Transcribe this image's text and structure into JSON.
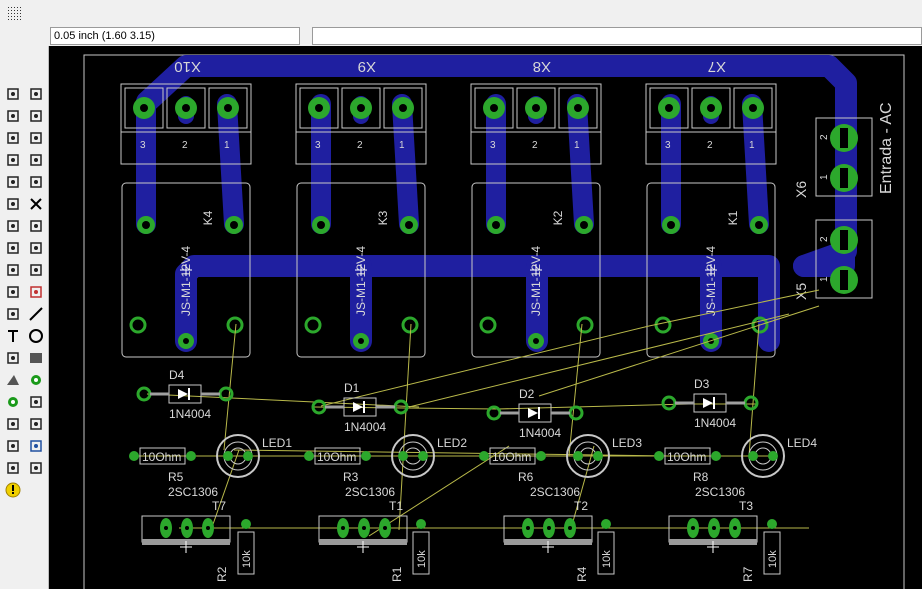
{
  "coord_readout": "0.05 inch (1.60 3.15)",
  "command_value": "",
  "toolbar": {
    "tools": [
      "info",
      "show",
      "display-layers",
      "mark",
      "move",
      "copy",
      "mirror",
      "rotate",
      "group",
      "change",
      "paste",
      "delete",
      "add",
      "name",
      "value",
      "smash",
      "split",
      "miter",
      "optimize",
      "route",
      "ripup",
      "wire",
      "text",
      "circle",
      "arc",
      "rect",
      "polygon",
      "via",
      "signal",
      "hole",
      "attribute",
      "dimension",
      "ratsnest",
      "drc",
      "auto-route",
      "errc",
      "errors"
    ]
  },
  "board": {
    "edge_color": "#c8c8c8",
    "bottom_copper_color": "#1f1fa0",
    "pad_color": "#2ca82c",
    "airwire_color": "#b9b94a",
    "label_color": "#d8d8d8",
    "connectors_top": [
      {
        "name": "X10",
        "pins": [
          "3",
          "2",
          "1"
        ]
      },
      {
        "name": "X9",
        "pins": [
          "3",
          "2",
          "1"
        ]
      },
      {
        "name": "X8",
        "pins": [
          "3",
          "2",
          "1"
        ]
      },
      {
        "name": "X7",
        "pins": [
          "3",
          "2",
          "1"
        ]
      }
    ],
    "relays": [
      {
        "name": "K4",
        "value": "JS-M1-12V-4"
      },
      {
        "name": "K3",
        "value": "JS-M1-12V-4"
      },
      {
        "name": "K2",
        "value": "JS-M1-12V-4"
      },
      {
        "name": "K1",
        "value": "JS-M1-12V-4"
      }
    ],
    "diodes": [
      {
        "name": "D4",
        "value": "1N4004"
      },
      {
        "name": "D1",
        "value": "1N4004"
      },
      {
        "name": "D2",
        "value": "1N4004"
      },
      {
        "name": "D3",
        "value": "1N4004"
      }
    ],
    "resistors_row": [
      {
        "name": "R5",
        "value": "10Ohm"
      },
      {
        "name": "R3",
        "value": "10Ohm"
      },
      {
        "name": "R6",
        "value": "10Ohm"
      },
      {
        "name": "R8",
        "value": "10Ohm"
      }
    ],
    "leds": [
      "LED1",
      "LED2",
      "LED3",
      "LED4"
    ],
    "transistors": [
      {
        "name": "T7",
        "value": "2SC1306"
      },
      {
        "name": "T1",
        "value": "2SC1306"
      },
      {
        "name": "T2",
        "value": "2SC1306"
      },
      {
        "name": "T3",
        "value": "2SC1306"
      }
    ],
    "resistors_vertical": [
      {
        "name": "R2",
        "value": "10k"
      },
      {
        "name": "R1",
        "value": "10k"
      },
      {
        "name": "R4",
        "value": "10k"
      },
      {
        "name": "R7",
        "value": "10k"
      }
    ],
    "power_connectors": [
      {
        "name": "X6",
        "pins": [
          "2",
          "1"
        ]
      },
      {
        "name": "X5",
        "pins": [
          "2",
          "1"
        ]
      }
    ],
    "side_label": "Entrada - AC"
  }
}
